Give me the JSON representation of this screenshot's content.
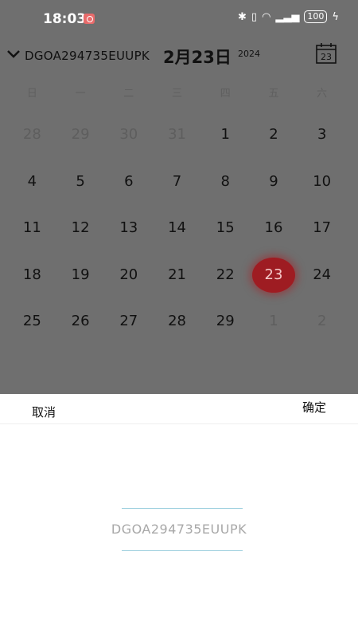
{
  "status_bar": {
    "time": "18:03",
    "battery": "100"
  },
  "header": {
    "device_id": "DGOA294735EUUPK",
    "date_title": "2月23日",
    "year": "2024",
    "calendar_icon_day": "23"
  },
  "weekdays": [
    "日",
    "一",
    "二",
    "三",
    "四",
    "五",
    "六"
  ],
  "calendar": {
    "selected": "23",
    "rows": [
      [
        {
          "d": "28",
          "m": true
        },
        {
          "d": "29",
          "m": true
        },
        {
          "d": "30",
          "m": true
        },
        {
          "d": "31",
          "m": true
        },
        {
          "d": "1"
        },
        {
          "d": "2"
        },
        {
          "d": "3"
        }
      ],
      [
        {
          "d": "4"
        },
        {
          "d": "5"
        },
        {
          "d": "6"
        },
        {
          "d": "7"
        },
        {
          "d": "8"
        },
        {
          "d": "9"
        },
        {
          "d": "10"
        }
      ],
      [
        {
          "d": "11"
        },
        {
          "d": "12"
        },
        {
          "d": "13"
        },
        {
          "d": "14"
        },
        {
          "d": "15"
        },
        {
          "d": "16"
        },
        {
          "d": "17"
        }
      ],
      [
        {
          "d": "18"
        },
        {
          "d": "19"
        },
        {
          "d": "20"
        },
        {
          "d": "21"
        },
        {
          "d": "22"
        },
        {
          "d": "23",
          "sel": true
        },
        {
          "d": "24"
        }
      ],
      [
        {
          "d": "25"
        },
        {
          "d": "26"
        },
        {
          "d": "27"
        },
        {
          "d": "28"
        },
        {
          "d": "29"
        },
        {
          "d": "1",
          "m": true
        },
        {
          "d": "2",
          "m": true
        }
      ]
    ]
  },
  "sheet": {
    "cancel_label": "取消",
    "confirm_label": "确定",
    "picker_option": "DGOA294735EUUPK"
  },
  "colors": {
    "overlay": "#6f6f6f",
    "selected": "#9e1c22",
    "picker_line": "#9fd0df"
  }
}
